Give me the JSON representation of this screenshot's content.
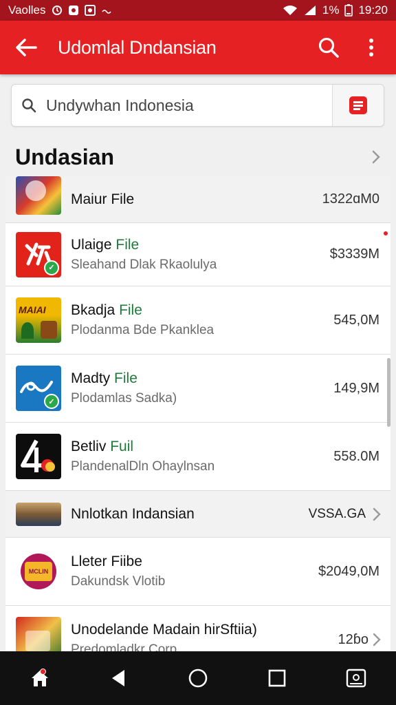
{
  "status_bar": {
    "carrier": "Vaolles",
    "battery": "1%",
    "time": "19:20"
  },
  "app_bar": {
    "title": "Udomlal Dndansian"
  },
  "search": {
    "text": "Undywhan Indonesia"
  },
  "section": {
    "title": "Undasian"
  },
  "rows": [
    {
      "name": "Maiur File",
      "size": "1322ɑM0"
    },
    {
      "name_a": "Ulaige",
      "name_b": "File",
      "subtitle": "Sleahand Dlak Rkaolulya",
      "size": "$3339M"
    },
    {
      "name_a": "Bkadja",
      "name_b": "File",
      "subtitle": "Plodanma Bde Pkanklea",
      "size": "545,0M",
      "thumb_text": "MAIAI"
    },
    {
      "name_a": "Madty",
      "name_b": "File",
      "subtitle": "Plodamlas Sadka)",
      "size": "149,9M"
    },
    {
      "name_a": "Betliv",
      "name_b": "Fuil",
      "subtitle": "PlandenalDln Ohaylnsan",
      "size": "558.0M"
    },
    {
      "name": "Nnlotkan Indansian",
      "tag": "VSSA.GA"
    },
    {
      "name": "Lleter Fiibe",
      "subtitle": "Dakundsk Vlotib",
      "size": "$2049,0M",
      "thumb_text": "MCLIN"
    },
    {
      "name": "Unodelande Madain hirSftiia)",
      "subtitle": "Predomladkr Corp",
      "size": "12ɓo"
    }
  ],
  "colors": {
    "brand_red": "#e52124",
    "status_red": "#a3141c",
    "accent_green": "#1f7a3a"
  },
  "icons": [
    "back-arrow-icon",
    "search-icon",
    "more-vert-icon",
    "filter-icon",
    "chevron-right-icon",
    "home-icon",
    "back-icon",
    "home-circle-icon",
    "recents-icon",
    "screenshot-icon"
  ]
}
